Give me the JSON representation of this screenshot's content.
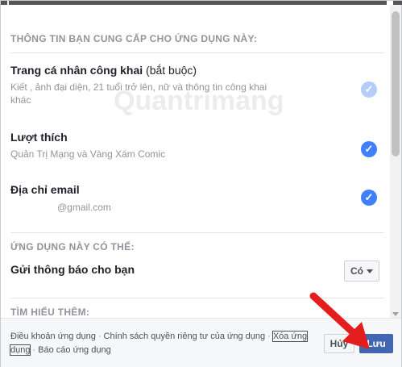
{
  "sections": {
    "info_title": "THÔNG TIN BẠN CUNG CẤP CHO ỨNG DỤNG NÀY:",
    "can_title": "ỨNG DỤNG NÀY CÓ THỂ:",
    "learn_title": "TÌM HIỂU THÊM:"
  },
  "profile": {
    "title": "Trang cá nhân công khai",
    "required": " (bắt buộc)",
    "desc": "Kiết                , ảnh đại diện, 21 tuổi trở lên, nữ và thông tin công khai khác"
  },
  "likes": {
    "title": "Lượt thích",
    "desc": "Quản Trị Mạng và Vàng Xám Comic"
  },
  "email": {
    "title": "Địa chỉ email",
    "desc": "@gmail.com"
  },
  "notify": {
    "label": "Gửi thông báo cho bạn",
    "selected": "Có"
  },
  "footer": {
    "terms": "Điều khoản ứng dụng",
    "privacy": "Chính sách quyền riêng tư của ứng dụng",
    "delete_a": "Xóa ứng",
    "delete_b": "dụng",
    "report": "Báo cáo ứng dụng",
    "sep": "·",
    "cancel": "Hủy",
    "save": "Lưu"
  },
  "watermark": "Quantrimang",
  "colors": {
    "accent": "#4267b2",
    "check": "#4080ff",
    "arrow": "#e41e1e"
  }
}
